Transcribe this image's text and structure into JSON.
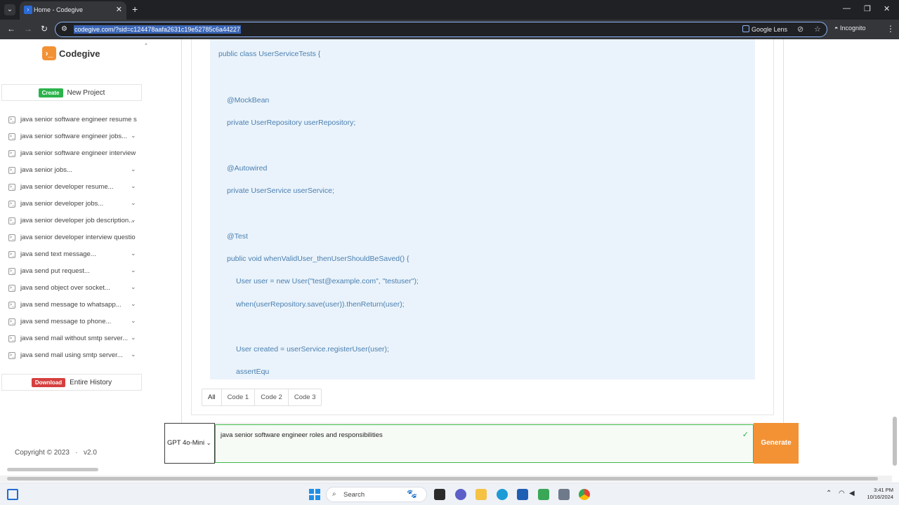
{
  "browser": {
    "tab_title": "Home - Codegive",
    "url": "codegive.com/?sid=c124478aafa2631c19e52785c6a44227",
    "google_lens": "Google Lens",
    "mode": "Incognito"
  },
  "sidebar": {
    "brand": "Codegive",
    "create_badge": "Create",
    "create_label": "New Project",
    "history": [
      {
        "label": "java senior software engineer resume s",
        "chevron": ""
      },
      {
        "label": "java senior software engineer jobs...",
        "chevron": "⌄"
      },
      {
        "label": "java senior software engineer interview",
        "chevron": ""
      },
      {
        "label": "java senior jobs...",
        "chevron": "⌄"
      },
      {
        "label": "java senior developer resume...",
        "chevron": "⌄"
      },
      {
        "label": "java senior developer jobs...",
        "chevron": "⌄"
      },
      {
        "label": "java senior developer job description...",
        "chevron": "⌄"
      },
      {
        "label": "java senior developer interview questio",
        "chevron": ""
      },
      {
        "label": "java send text message...",
        "chevron": "⌄"
      },
      {
        "label": "java send put request...",
        "chevron": "⌄"
      },
      {
        "label": "java send object over socket...",
        "chevron": "⌄"
      },
      {
        "label": "java send message to whatsapp...",
        "chevron": "⌄"
      },
      {
        "label": "java send message to phone...",
        "chevron": "⌄"
      },
      {
        "label": "java send mail without smtp server...",
        "chevron": "⌄"
      },
      {
        "label": "java send mail using smtp server...",
        "chevron": "⌄"
      }
    ],
    "download_badge": "Download",
    "download_label": "Entire History",
    "copyright": "Copyright © 2023",
    "version": "v2.0"
  },
  "code": {
    "lines": [
      "public class UserServiceTests {",
      "@MockBean",
      "private UserRepository userRepository;",
      "@Autowired",
      "private UserService userService;",
      "@Test",
      "public void whenValidUser_thenUserShouldBeSaved() {",
      "User user = new User(\"test@example.com\", \"testuser\");",
      "when(userRepository.save(user)).thenReturn(user);",
      "User created = userService.registerUser(user);",
      "assertEqu"
    ]
  },
  "code_tabs": [
    "All",
    "Code 1",
    "Code 2",
    "Code 3"
  ],
  "input": {
    "model": "GPT 4o-Mini",
    "prompt": "java senior software engineer roles and responsibilities",
    "generate_label": "Generate"
  },
  "taskbar": {
    "search_label": "Search",
    "time": "3:41 PM",
    "date": "10/16/2024"
  }
}
